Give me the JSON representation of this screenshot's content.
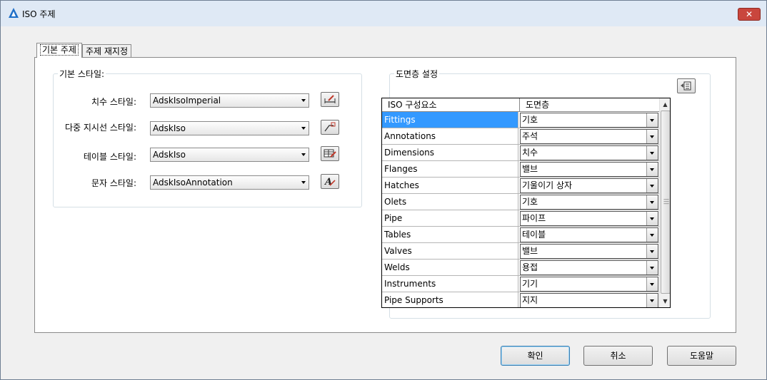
{
  "window": {
    "title": "ISO 주제",
    "close_label": "✕",
    "close_icon": "close-icon",
    "app_icon": "autocad-triangle-icon"
  },
  "tabs": [
    {
      "label": "기본 주제",
      "active": true
    },
    {
      "label": "주제 재지정",
      "active": false
    }
  ],
  "basic_style": {
    "group_title": "기본 스타일:",
    "rows": [
      {
        "label": "치수 스타일:",
        "value": "AdskIsoImperial",
        "icon": "dimension-style-icon"
      },
      {
        "label": "다중 지시선 스타일:",
        "value": "AdskIso",
        "icon": "multileader-style-icon"
      },
      {
        "label": "테이블 스타일:",
        "value": "AdskIso",
        "icon": "table-style-icon"
      },
      {
        "label": "문자 스타일:",
        "value": "AdskIsoAnnotation",
        "icon": "text-style-icon"
      }
    ]
  },
  "layer_settings": {
    "group_title": "도면층 설정",
    "toolbar_icon": "layer-properties-icon",
    "columns": [
      "ISO 구성요소",
      "도면층"
    ],
    "rows": [
      {
        "component": "Fittings",
        "layer": "기호",
        "selected": true
      },
      {
        "component": "Annotations",
        "layer": "주석"
      },
      {
        "component": "Dimensions",
        "layer": "치수"
      },
      {
        "component": "Flanges",
        "layer": "밸브"
      },
      {
        "component": "Hatches",
        "layer": "기울이기 상자"
      },
      {
        "component": "Olets",
        "layer": "기호"
      },
      {
        "component": "Pipe",
        "layer": "파이프"
      },
      {
        "component": "Tables",
        "layer": "테이블"
      },
      {
        "component": "Valves",
        "layer": "밸브"
      },
      {
        "component": "Welds",
        "layer": "용접"
      },
      {
        "component": "Instruments",
        "layer": "기기"
      },
      {
        "component": "Pipe Supports",
        "layer": "지지"
      }
    ]
  },
  "buttons": {
    "ok": "확인",
    "cancel": "취소",
    "help": "도움말"
  }
}
